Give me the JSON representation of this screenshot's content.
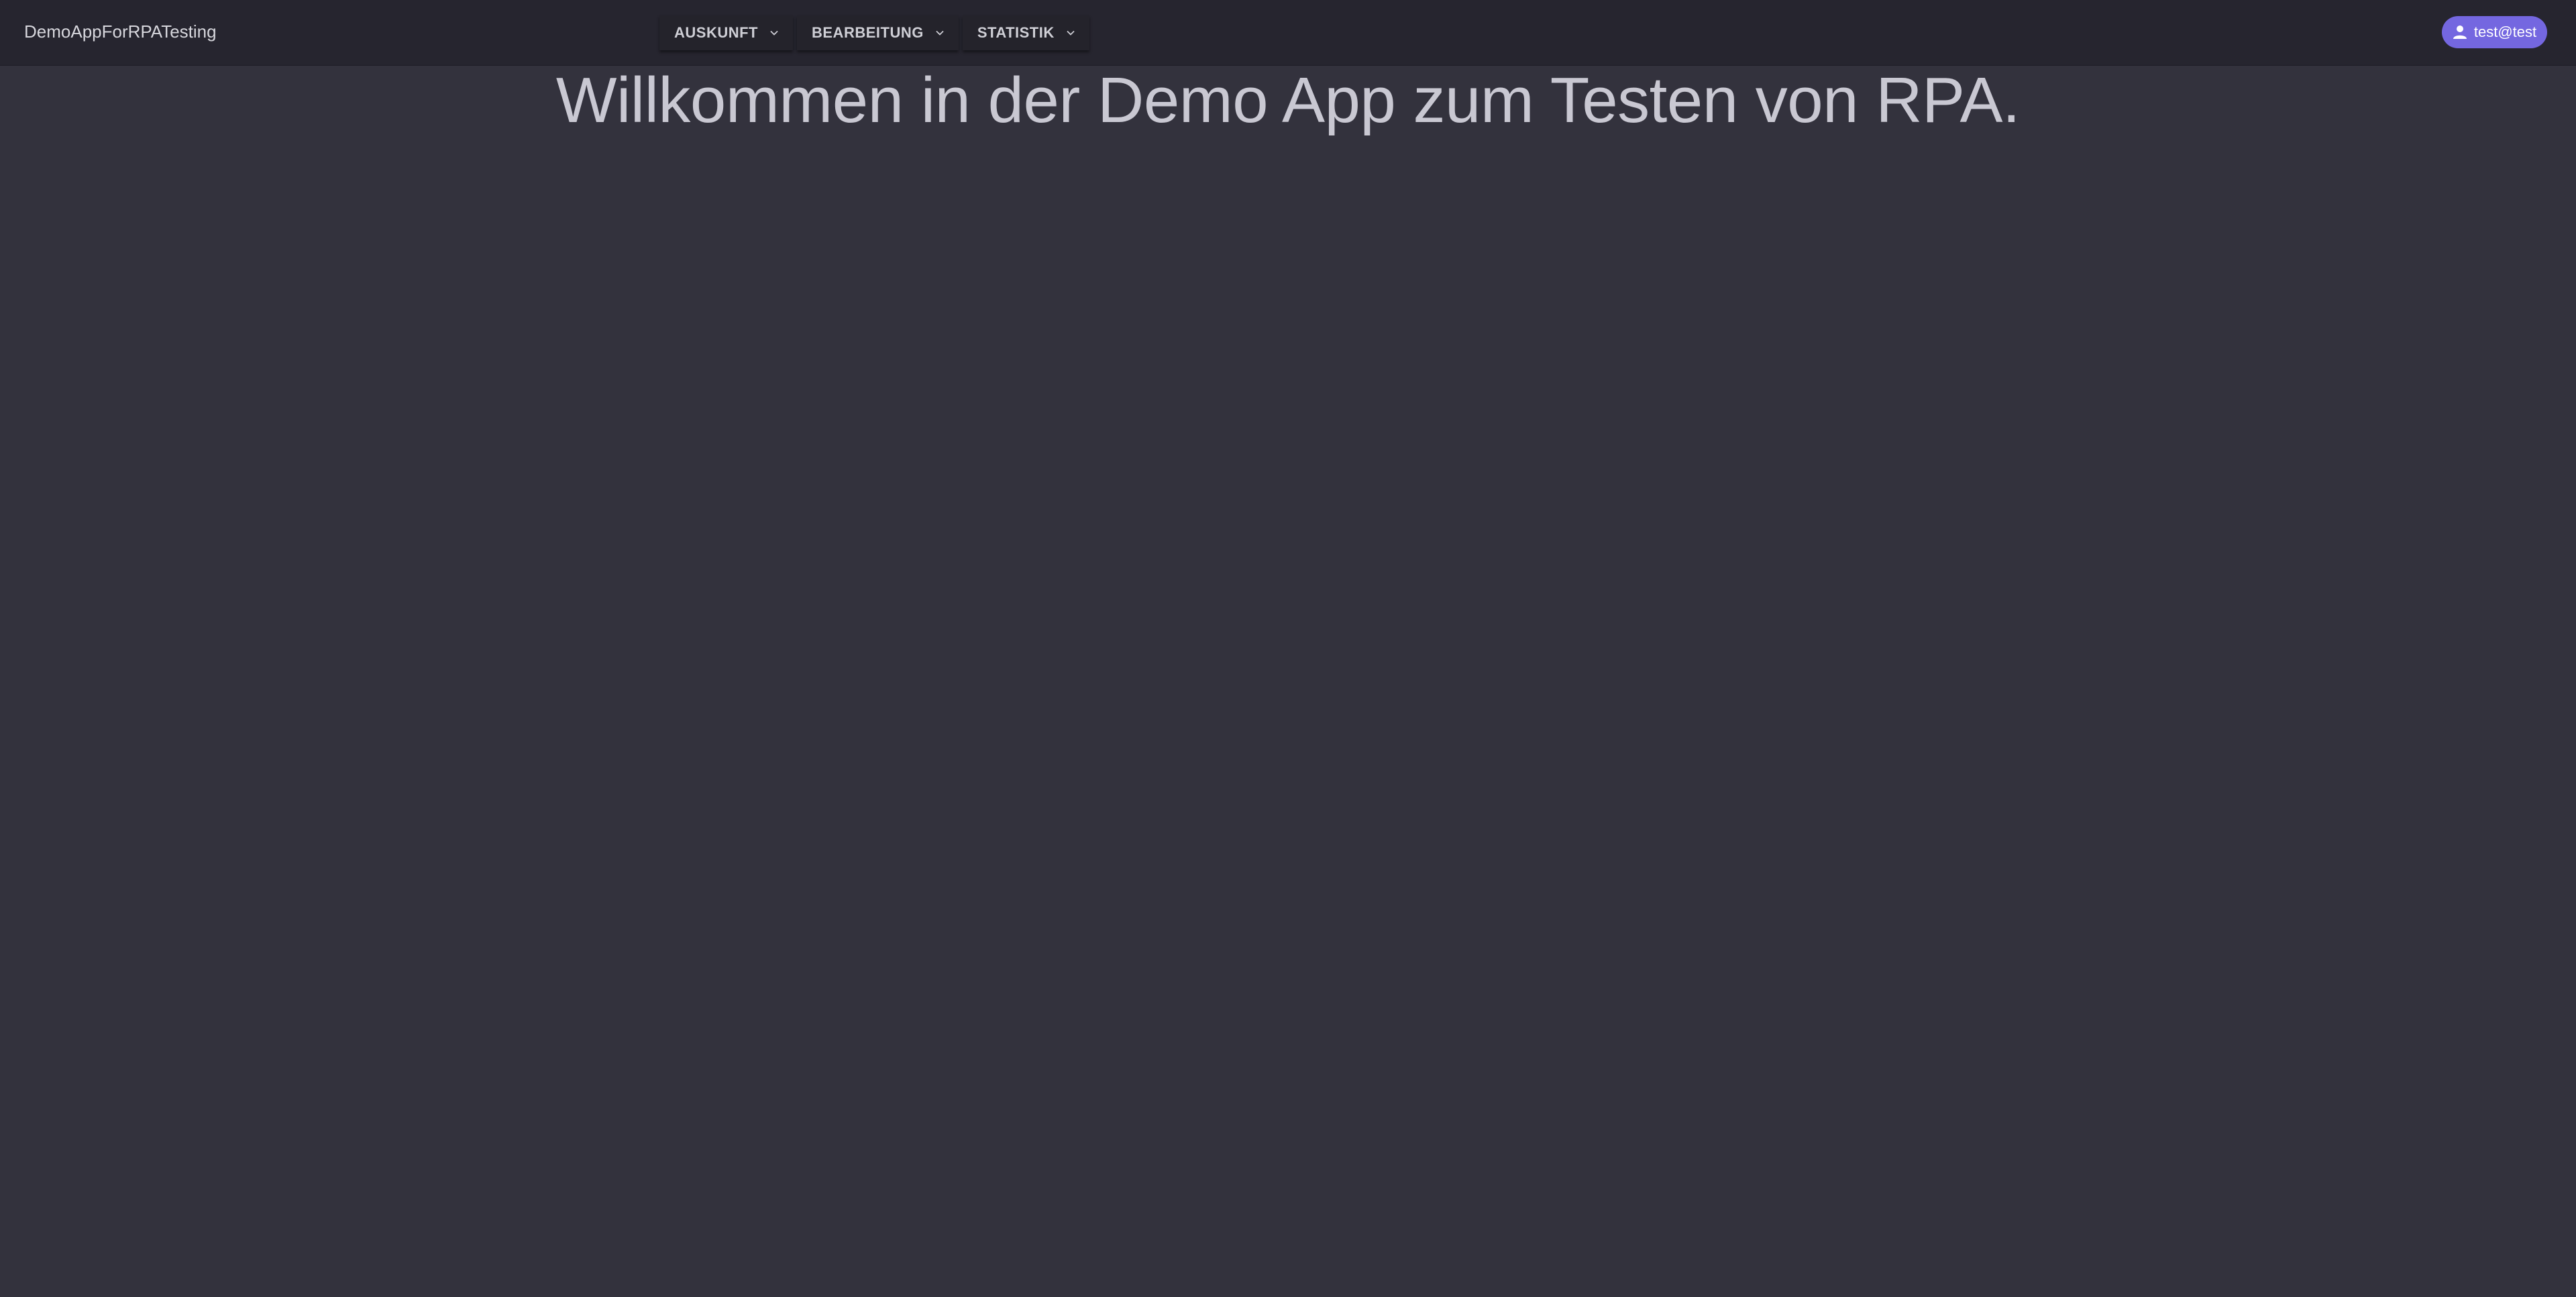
{
  "header": {
    "brand": "DemoAppForRPATesting",
    "nav": [
      {
        "label": "AUSKUNFT",
        "icon": "chevron-down-icon"
      },
      {
        "label": "BEARBEITUNG",
        "icon": "chevron-down-icon"
      },
      {
        "label": "STATISTIK",
        "icon": "chevron-down-icon"
      }
    ],
    "user": {
      "label": "test@test",
      "icon": "person-icon",
      "color": "#7467e0"
    }
  },
  "main": {
    "title": "Willkommen in der Demo App zum Testen von RPA."
  }
}
